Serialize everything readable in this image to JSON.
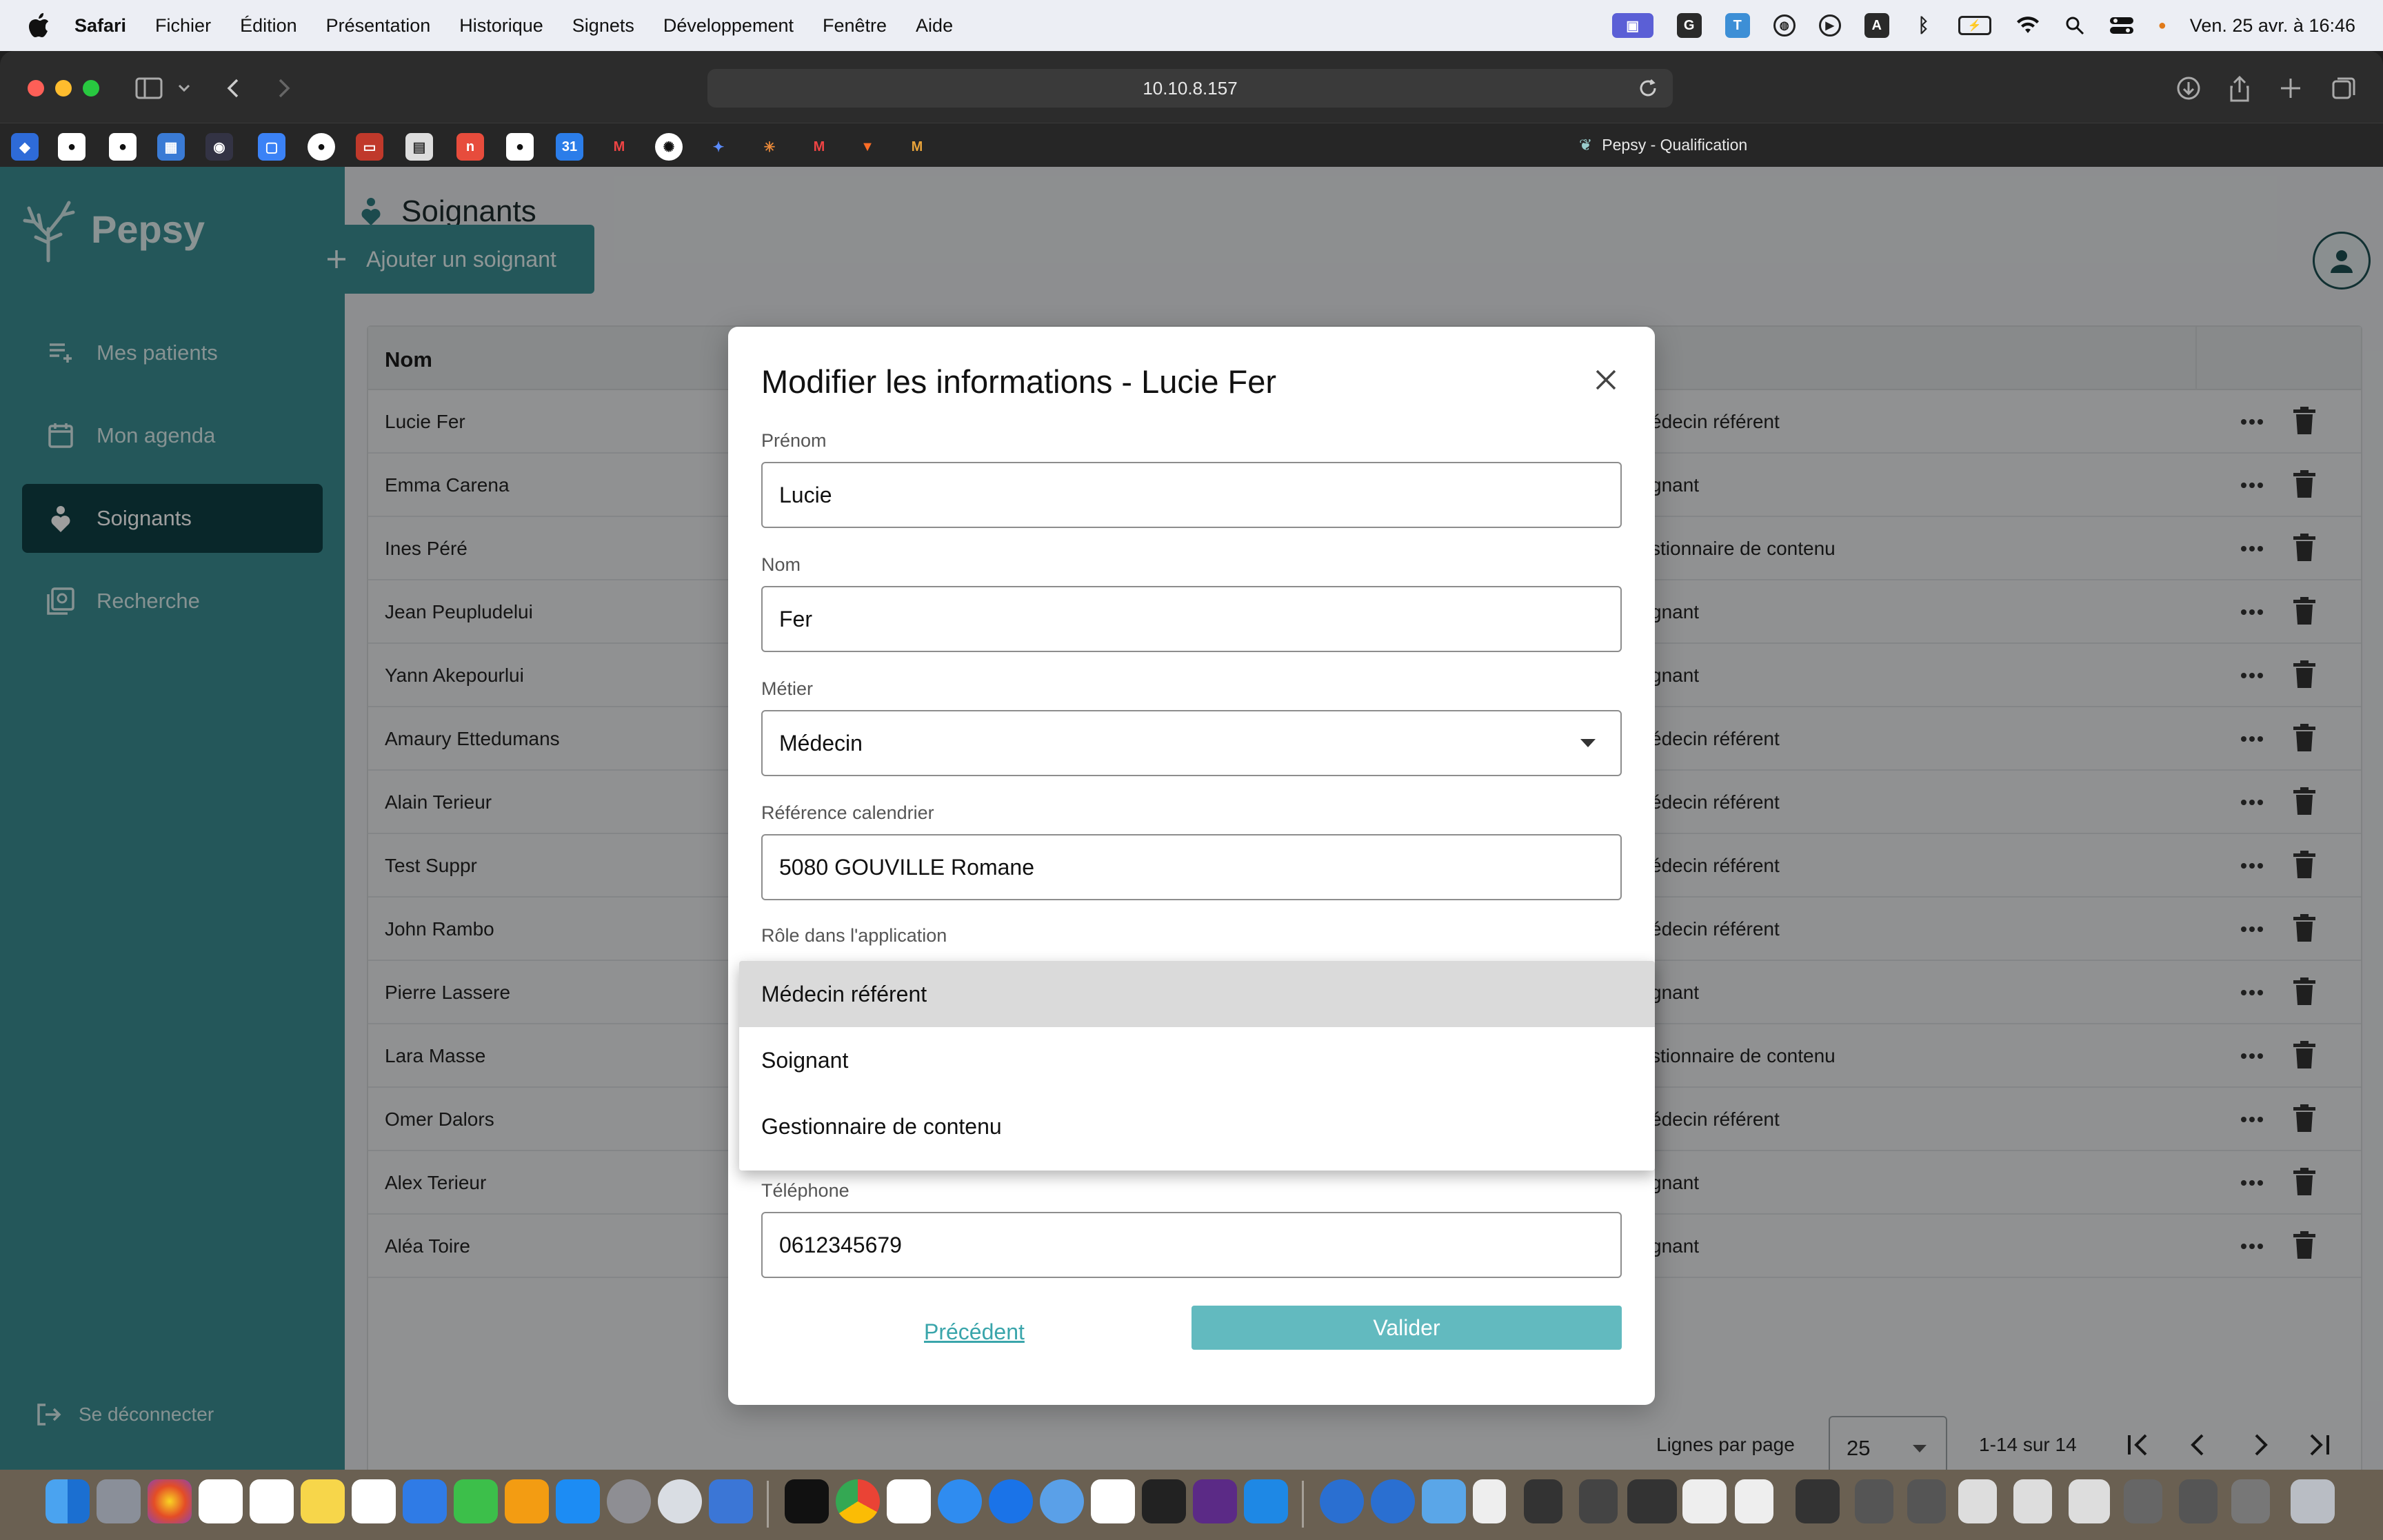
{
  "menubar": {
    "items": [
      "Safari",
      "Fichier",
      "Édition",
      "Présentation",
      "Historique",
      "Signets",
      "Développement",
      "Fenêtre",
      "Aide"
    ],
    "datetime": "Ven. 25 avr. à 16:46"
  },
  "browser": {
    "url": "10.10.8.157",
    "tab_title": "Pepsy - Qualification"
  },
  "sidebar": {
    "brand": "Pepsy",
    "items": [
      {
        "label": "Mes patients",
        "active": false
      },
      {
        "label": "Mon agenda",
        "active": false
      },
      {
        "label": "Soignants",
        "active": true
      },
      {
        "label": "Recherche",
        "active": false
      }
    ],
    "logout": "Se déconnecter"
  },
  "page": {
    "title": "Soignants",
    "add_button": "Ajouter un soignant"
  },
  "table": {
    "header_name": "Nom",
    "rows": [
      {
        "name": "Lucie Fer",
        "role": "édecin référent"
      },
      {
        "name": "Emma Carena",
        "role": "gnant"
      },
      {
        "name": "Ines Péré",
        "role": "stionnaire de contenu"
      },
      {
        "name": "Jean Peupludelui",
        "role": "gnant"
      },
      {
        "name": "Yann Akepourlui",
        "role": "gnant"
      },
      {
        "name": "Amaury Ettedumans",
        "role": "édecin référent"
      },
      {
        "name": "Alain Terieur",
        "role": "édecin référent"
      },
      {
        "name": "Test Suppr",
        "role": "édecin référent"
      },
      {
        "name": "John Rambo",
        "role": "édecin référent"
      },
      {
        "name": "Pierre Lassere",
        "role": "gnant"
      },
      {
        "name": "Lara Masse",
        "role": "stionnaire de contenu"
      },
      {
        "name": "Omer Dalors",
        "role": "édecin référent"
      },
      {
        "name": "Alex Terieur",
        "role": "gnant"
      },
      {
        "name": "Aléa Toire",
        "role": "gnant"
      }
    ],
    "pagination": {
      "rows_label": "Lignes par page",
      "rows_value": "25",
      "count": "1-14 sur 14"
    }
  },
  "modal": {
    "title": "Modifier les informations - Lucie Fer",
    "fields": {
      "prenom": {
        "label": "Prénom",
        "value": "Lucie"
      },
      "nom": {
        "label": "Nom",
        "value": "Fer"
      },
      "metier": {
        "label": "Métier",
        "value": "Médecin"
      },
      "calendrier": {
        "label": "Référence calendrier",
        "value": "5080 GOUVILLE Romane"
      },
      "role": {
        "label": "Rôle dans l'application"
      },
      "telephone": {
        "label": "Téléphone",
        "value": "0612345679"
      }
    },
    "role_options": [
      "Médecin référent",
      "Soignant",
      "Gestionnaire de contenu"
    ],
    "previous": "Précédent",
    "submit": "Valider"
  },
  "colors": {
    "primary": "#3a8d92",
    "active_nav": "#0f3f44",
    "submit": "#62babf",
    "link": "#3aa5ab"
  }
}
